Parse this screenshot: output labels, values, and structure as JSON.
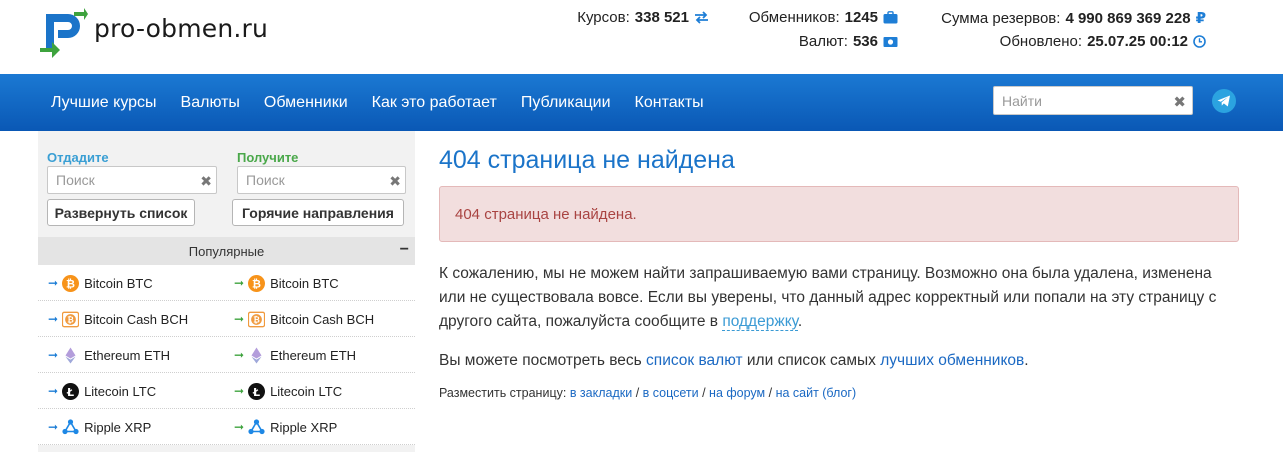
{
  "header": {
    "logo_text": "pro-obmen.ru",
    "stats": {
      "rates_label": "Курсов:",
      "rates_value": "338 521",
      "exchangers_label": "Обменников:",
      "exchangers_value": "1245",
      "currencies_label": "Валют:",
      "currencies_value": "536",
      "reserves_label": "Сумма резервов:",
      "reserves_value": "4 990 869 369 228",
      "currency_symbol": "₽",
      "updated_label": "Обновлено:",
      "updated_value": "25.07.25 00:12"
    }
  },
  "nav": {
    "items": [
      "Лучшие курсы",
      "Валюты",
      "Обменники",
      "Как это работает",
      "Публикации",
      "Контакты"
    ],
    "search_placeholder": "Найти"
  },
  "sidebar": {
    "give_label": "Отдадите",
    "get_label": "Получите",
    "search_placeholder": "Поиск",
    "expand_button": "Развернуть список",
    "hot_button": "Горячие направления",
    "popular_title": "Популярные",
    "popular_items": [
      {
        "name": "Bitcoin BTC",
        "icon": "bitcoin-icon"
      },
      {
        "name": "Bitcoin Cash BCH",
        "icon": "bitcoin-cash-icon"
      },
      {
        "name": "Ethereum ETH",
        "icon": "ethereum-icon"
      },
      {
        "name": "Litecoin LTC",
        "icon": "litecoin-icon"
      },
      {
        "name": "Ripple XRP",
        "icon": "ripple-icon"
      }
    ]
  },
  "main": {
    "title": "404 страница не найдена",
    "alert": "404 страница не найдена.",
    "p1_text": "К сожалению, мы не можем найти запрашиваемую вами страницу. Возможно она была удалена, изменена или не существовала вовсе. Если вы уверены, что данный адрес корректный или попали на эту страницу с другого сайта, пожалуйста сообщите в ",
    "p1_link": "поддержку",
    "p1_end": ".",
    "p2_start": "Вы можете посмотреть весь ",
    "p2_link1": "список валют",
    "p2_mid": " или список самых ",
    "p2_link2": "лучших обменников",
    "p2_end": ".",
    "share_label": "Разместить страницу: ",
    "share_links": [
      "в закладки",
      "в соцсети",
      "на форум",
      "на сайт (блог)"
    ],
    "share_sep": " / "
  },
  "colors": {
    "nav_bg": "#1b79d3",
    "title": "#1b74c9",
    "alert_bg": "#f2dede",
    "alert_text": "#a94442",
    "give_label": "#3a9fd4",
    "get_label": "#4aa84a"
  }
}
